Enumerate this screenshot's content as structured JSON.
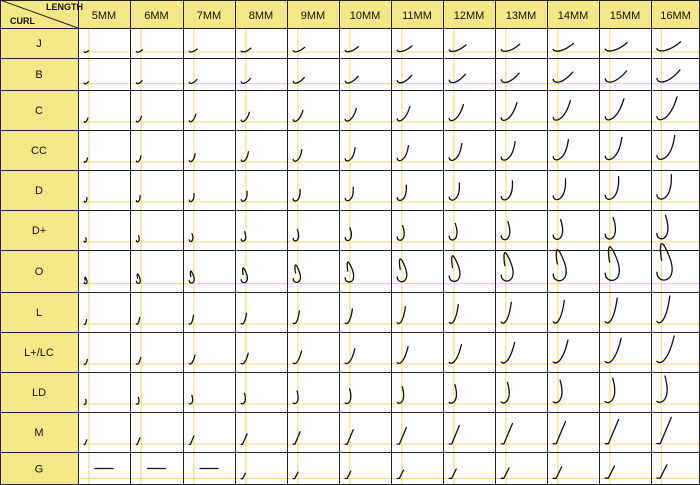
{
  "corner": {
    "top": "LENGTH",
    "bottom": "CURL"
  },
  "lengths": [
    "5MM",
    "6MM",
    "7MM",
    "8MM",
    "9MM",
    "10MM",
    "11MM",
    "12MM",
    "13MM",
    "14MM",
    "15MM",
    "16MM"
  ],
  "curls": [
    "J",
    "B",
    "C",
    "CC",
    "D",
    "D+",
    "O",
    "L",
    "L+/LC",
    "LD",
    "M",
    "G"
  ],
  "colors": {
    "header": "#f3e887",
    "grid_major": "#222222",
    "grid_minor": "#f0d870",
    "lash": "#111111",
    "background": "#ffffff"
  }
}
